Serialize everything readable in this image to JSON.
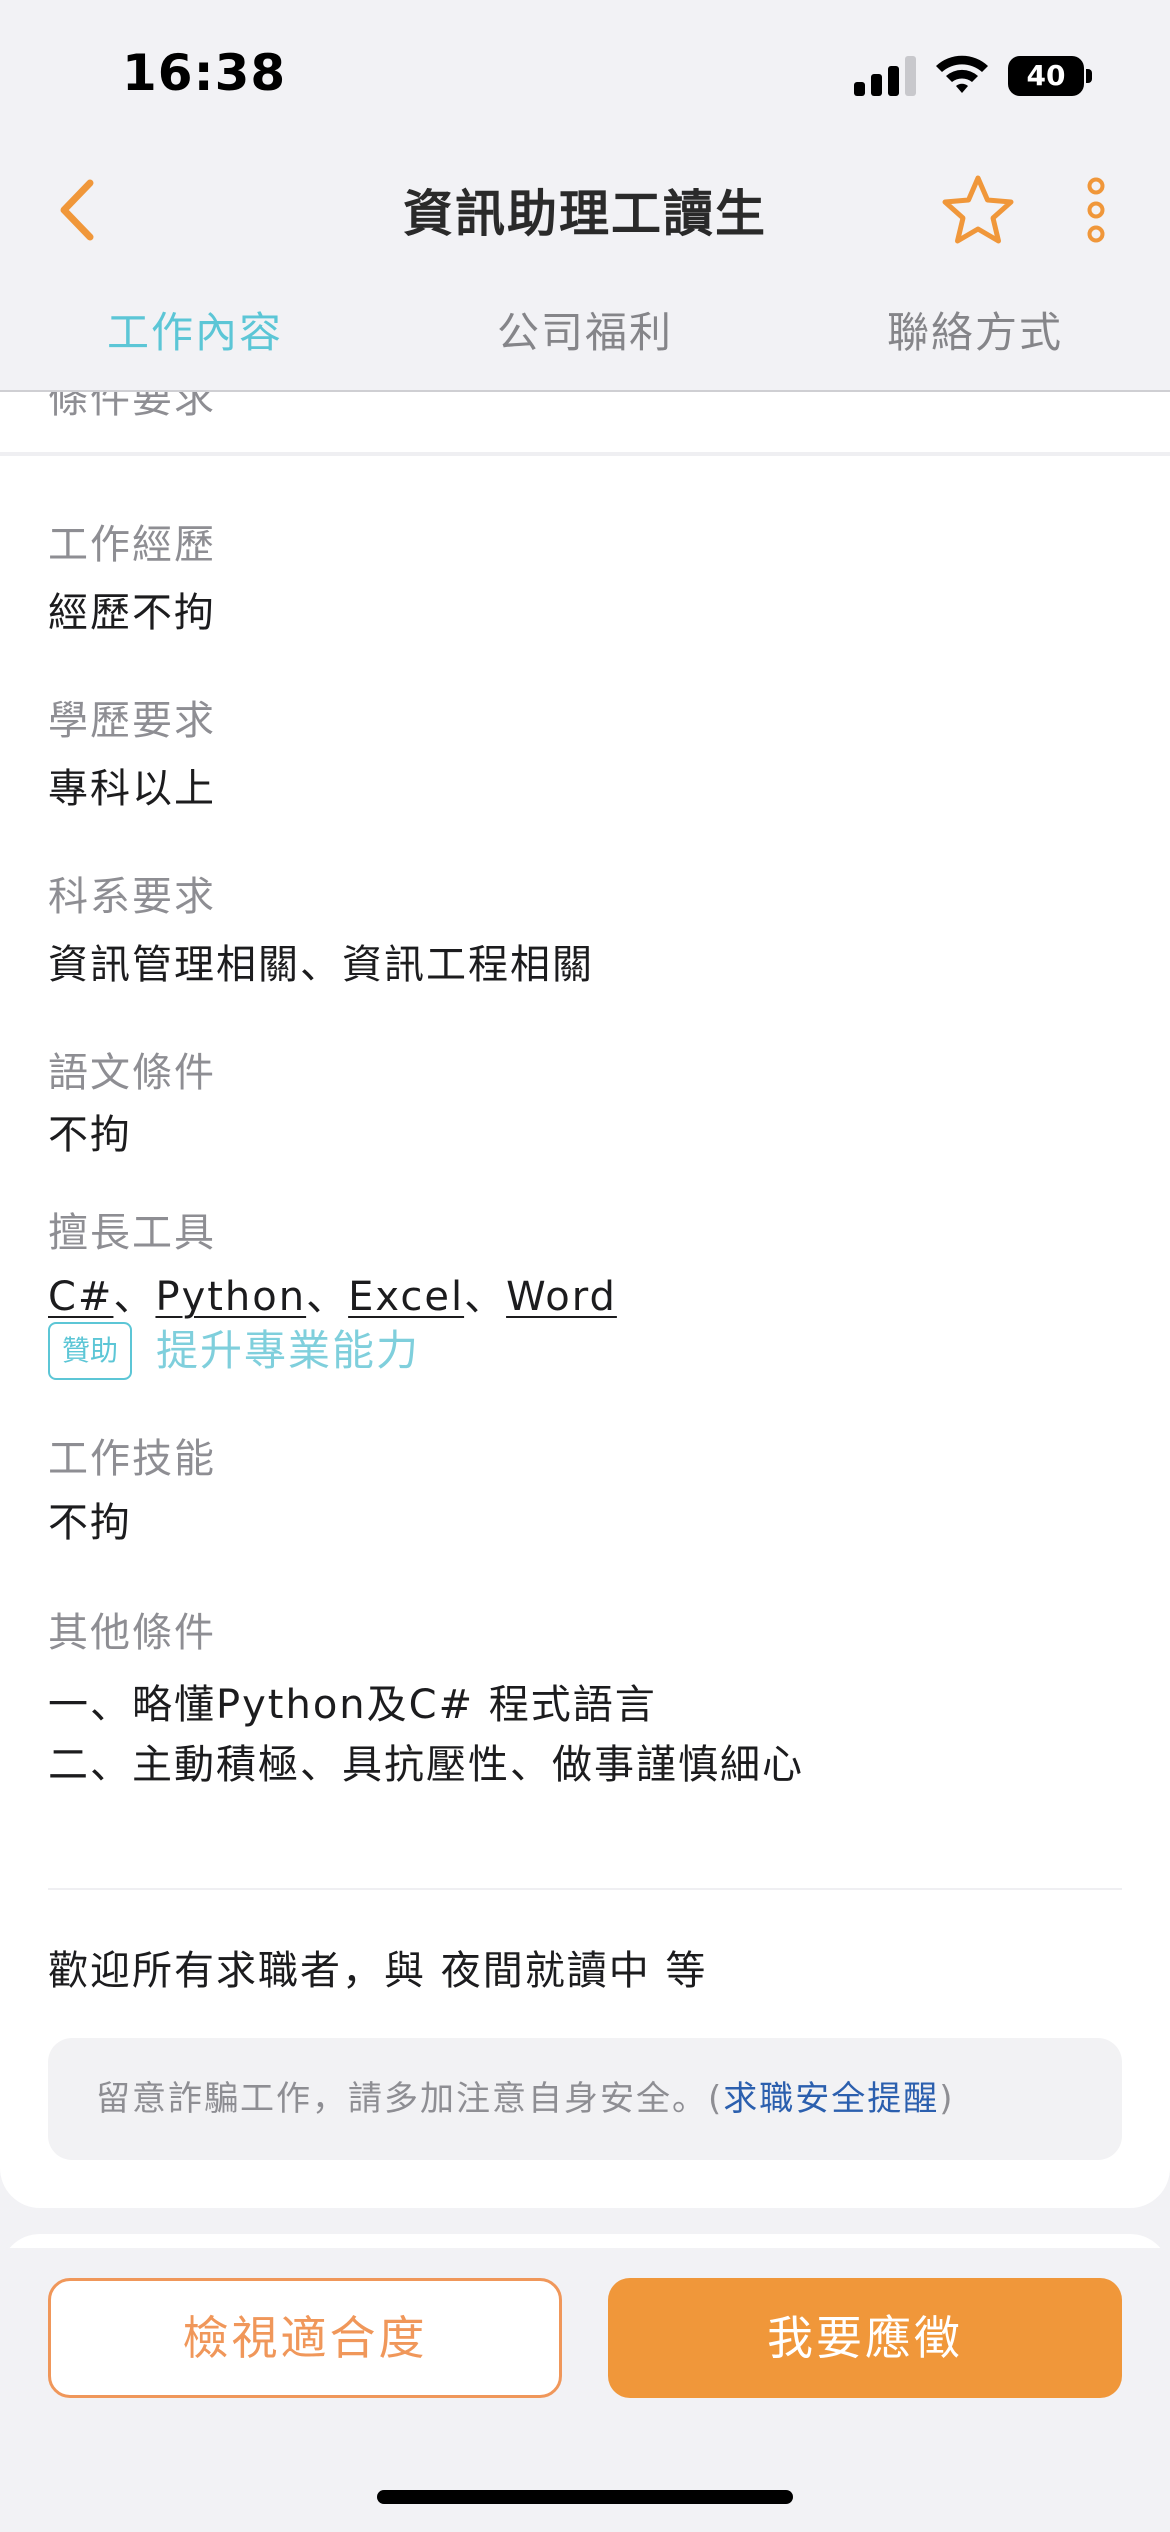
{
  "status_bar": {
    "time": "16:38",
    "battery_level": "40"
  },
  "nav": {
    "title": "資訊助理工讀生",
    "accent_color": "#f0973a"
  },
  "tabs": [
    {
      "label": "工作內容",
      "active": true
    },
    {
      "label": "公司福利",
      "active": false
    },
    {
      "label": "聯絡方式",
      "active": false
    }
  ],
  "section": {
    "header": "條件要求"
  },
  "fields": {
    "experience": {
      "label": "工作經歷",
      "value": "經歷不拘"
    },
    "education": {
      "label": "學歷要求",
      "value": "專科以上"
    },
    "department": {
      "label": "科系要求",
      "value": "資訊管理相關、資訊工程相關"
    },
    "language": {
      "label": "語文條件",
      "value": "不拘"
    },
    "tools": {
      "label": "擅長工具",
      "items": [
        "C#",
        "Python",
        "Excel",
        "Word"
      ],
      "separator": "、",
      "sponsor_badge": "贊助",
      "sponsor_link": "提升專業能力"
    },
    "skills": {
      "label": "工作技能",
      "value": "不拘"
    },
    "other": {
      "label": "其他條件",
      "lines": [
        "一、略懂Python及C# 程式語言",
        "二、主動積極、具抗壓性、做事謹慎細心"
      ]
    }
  },
  "welcome": "歡迎所有求職者，與 夜間就讀中 等",
  "notice": {
    "text": "留意詐騙工作，請多加注意自身安全。(",
    "link": "求職安全提醒",
    "close": ")"
  },
  "actions": {
    "fit_label": "檢視適合度",
    "apply_label": "我要應徵"
  }
}
